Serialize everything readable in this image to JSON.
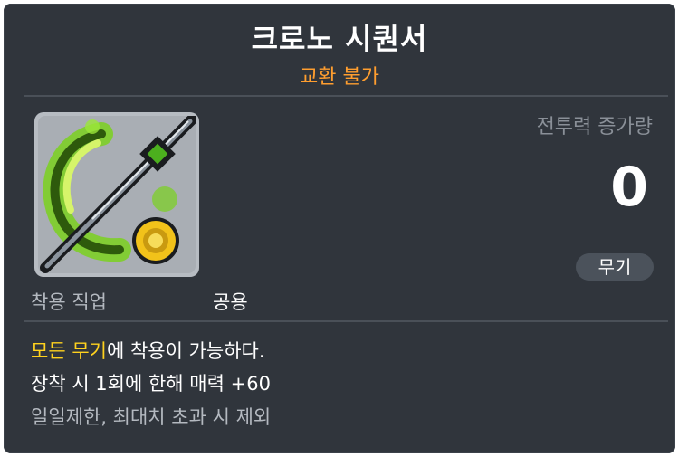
{
  "item": {
    "name": "크로노 시퀀서",
    "trade_status": "교환 불가",
    "power_label": "전투력 증가량",
    "power_value": "0",
    "type_badge": "무기",
    "job_label": "착용 직업",
    "job_value": "공용",
    "icon": "chrono-sequencer-weapon-icon"
  },
  "description": {
    "line1_highlight": "모든 무기",
    "line1_rest": "에 착용이 가능하다.",
    "line2": "장착 시 1회에 한해 매력 +60",
    "line3": "일일제한, 최대치 초과 시 제외"
  },
  "colors": {
    "background": "#30353c",
    "title": "#ffffff",
    "trade_status": "#ff9e2f",
    "highlight": "#ffd21e",
    "muted": "#b4b9c0",
    "badge_bg": "#4b525b"
  }
}
